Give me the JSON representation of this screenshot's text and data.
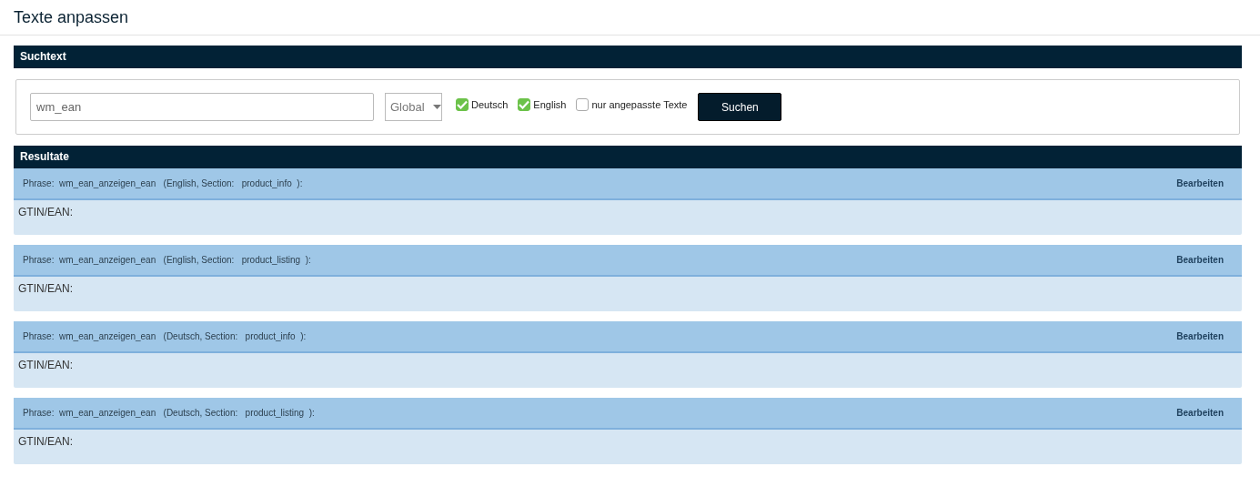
{
  "page_title": "Texte anpassen",
  "search_section": {
    "title": "Suchtext",
    "query": "wm_ean",
    "scope": "Global",
    "checkboxes": [
      {
        "label": "Deutsch",
        "checked": true
      },
      {
        "label": "English",
        "checked": true
      },
      {
        "label": "nur angepasste Texte",
        "checked": false
      }
    ],
    "button": "Suchen"
  },
  "results_section": {
    "title": "Resultate",
    "results": [
      {
        "phrase_label": "Phrase:",
        "phrase": "wm_ean_anzeigen_ean",
        "language": "(English, Section:",
        "section": "product_info",
        "closing": "):",
        "action": "Bearbeiten",
        "text": "GTIN/EAN:"
      },
      {
        "phrase_label": "Phrase:",
        "phrase": "wm_ean_anzeigen_ean",
        "language": "(English, Section:",
        "section": "product_listing",
        "closing": "):",
        "action": "Bearbeiten",
        "text": "GTIN/EAN:"
      },
      {
        "phrase_label": "Phrase:",
        "phrase": "wm_ean_anzeigen_ean",
        "language": "(Deutsch, Section:",
        "section": "product_info",
        "closing": "):",
        "action": "Bearbeiten",
        "text": "GTIN/EAN:"
      },
      {
        "phrase_label": "Phrase:",
        "phrase": "wm_ean_anzeigen_ean",
        "language": "(Deutsch, Section:",
        "section": "product_listing",
        "closing": "):",
        "action": "Bearbeiten",
        "text": "GTIN/EAN:"
      }
    ]
  }
}
